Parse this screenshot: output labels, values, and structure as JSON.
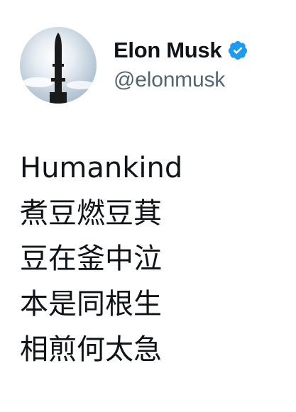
{
  "author": {
    "display_name": "Elon Musk",
    "handle": "@elonmusk",
    "verified": true,
    "verified_color": "#1d9bf0",
    "avatar_icon": "starship-avatar-icon"
  },
  "tweet": {
    "lines": [
      "Humankind",
      "煮豆燃豆萁",
      "豆在釜中泣",
      "本是同根生",
      "相煎何太急"
    ]
  }
}
